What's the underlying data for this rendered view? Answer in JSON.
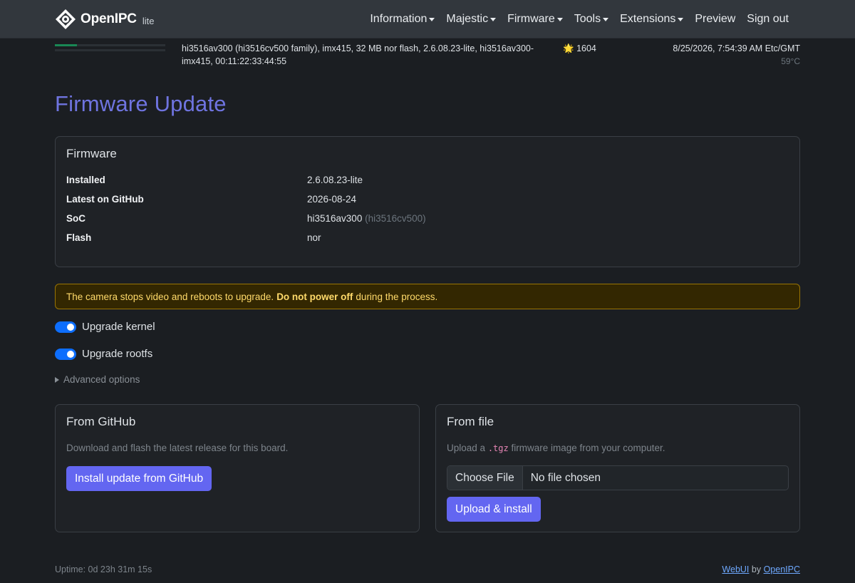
{
  "brand": {
    "name": "OpenIPC",
    "sub": "lite",
    "icon": "openipc-logo-icon"
  },
  "nav": {
    "items": [
      {
        "label": "Information",
        "dropdown": true
      },
      {
        "label": "Majestic",
        "dropdown": true
      },
      {
        "label": "Firmware",
        "dropdown": true
      },
      {
        "label": "Tools",
        "dropdown": true
      },
      {
        "label": "Extensions",
        "dropdown": true
      },
      {
        "label": "Preview",
        "dropdown": false
      },
      {
        "label": "Sign out",
        "dropdown": false
      }
    ]
  },
  "status": {
    "bars": [
      0.2,
      0.0
    ],
    "bar_color": "#198754",
    "sysinfo": "hi3516av300 (hi3516cv500 family), imx415, 32 MB nor flash, 2.6.08.23-lite, hi3516av300-imx415, 00:11:22:33:44:55",
    "stars_icon": "🌟",
    "stars": "1604",
    "datetime": "8/25/2026, 7:54:39 AM Etc/GMT",
    "temperature": "59°C"
  },
  "page": {
    "title": "Firmware Update"
  },
  "firmware": {
    "title": "Firmware",
    "rows": [
      {
        "label": "Installed",
        "value": "2.6.08.23-lite",
        "extra": ""
      },
      {
        "label": "Latest on GitHub",
        "value": "2026-08-24",
        "extra": ""
      },
      {
        "label": "SoC",
        "value": "hi3516av300",
        "extra": "(hi3516cv500)"
      },
      {
        "label": "Flash",
        "value": "nor",
        "extra": ""
      }
    ]
  },
  "alert": {
    "pre": "The camera stops video and reboots to upgrade.",
    "bold": "Do not power off",
    "post": "during the process.",
    "bg": "#332701",
    "color": "#ffda6a"
  },
  "options": {
    "kernel": {
      "label": "Upgrade kernel",
      "checked": true
    },
    "rootfs": {
      "label": "Upgrade rootfs",
      "checked": true
    },
    "advanced": "Advanced options"
  },
  "github": {
    "title": "From GitHub",
    "desc": "Download and flash the latest release for this board.",
    "button": "Install update from GitHub"
  },
  "file": {
    "title": "From file",
    "desc_pre": "Upload a",
    "desc_code": ".tgz",
    "desc_post": "firmware image from your computer.",
    "choose": "Choose File",
    "chosen": "No file chosen",
    "button": "Upload & install"
  },
  "footer": {
    "uptime": "Uptime: 0d 23h 31m 15s",
    "webui": "WebUI",
    "by": "by",
    "openipc": "OpenIPC"
  },
  "colors": {
    "accent": "#6366f1",
    "title": "#6f74e0",
    "switch": "#0d6efd"
  }
}
